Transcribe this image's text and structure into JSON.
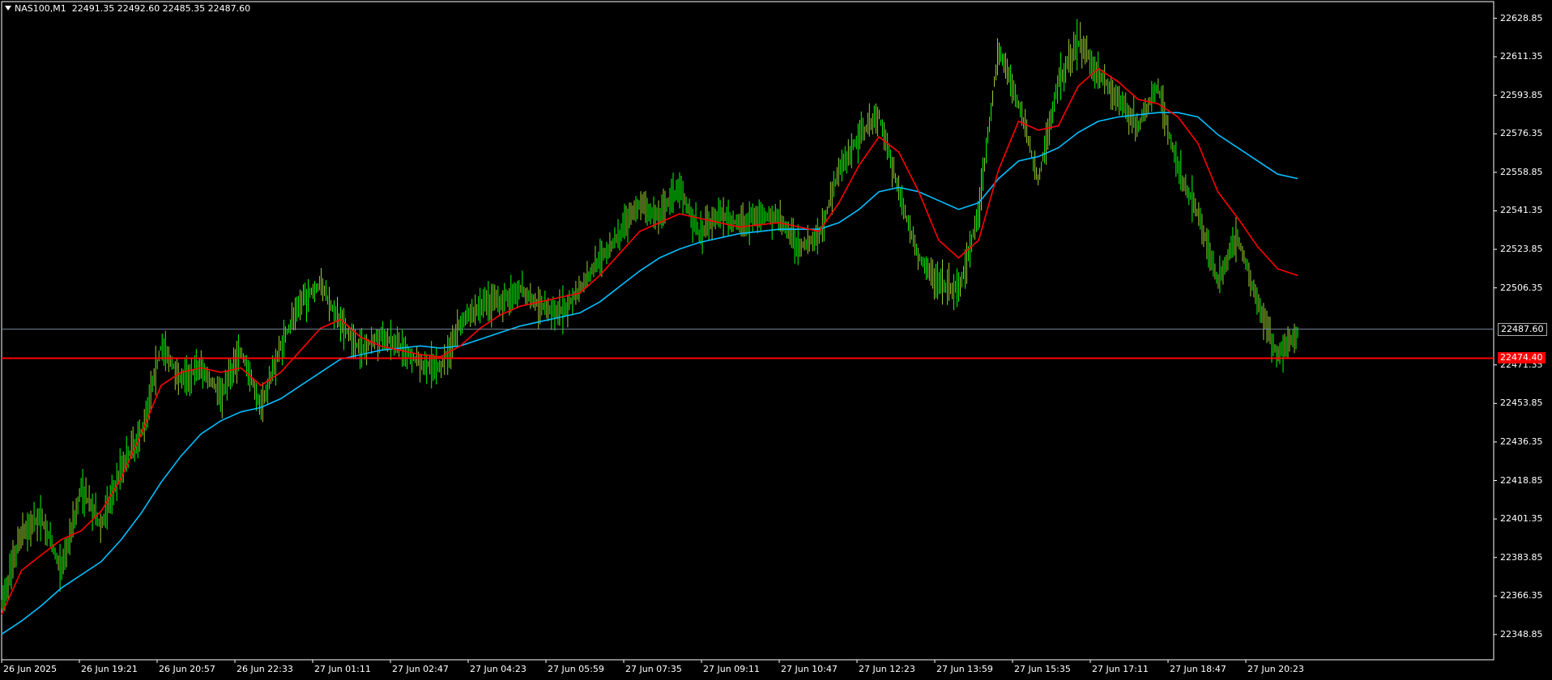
{
  "header": {
    "symbol": "NAS100,M1",
    "ohlc": "22491.35 22492.60 22485.35 22487.60"
  },
  "price_axis": {
    "labels": [
      "22628.85",
      "22611.35",
      "22593.85",
      "22576.35",
      "22558.85",
      "22541.35",
      "22523.85",
      "22506.35",
      "22471.35",
      "22453.85",
      "22436.35",
      "22418.85",
      "22401.35",
      "22383.85",
      "22366.35",
      "22348.85"
    ],
    "bid_label": "22487.60",
    "alert_label": "22474.40"
  },
  "time_axis": {
    "labels": [
      "26 Jun 2025",
      "26 Jun 19:21",
      "26 Jun 20:57",
      "26 Jun 22:33",
      "27 Jun 01:11",
      "27 Jun 02:47",
      "27 Jun 04:23",
      "27 Jun 05:59",
      "27 Jun 07:35",
      "27 Jun 09:11",
      "27 Jun 10:47",
      "27 Jun 12:23",
      "27 Jun 13:59",
      "27 Jun 15:35",
      "27 Jun 17:11",
      "27 Jun 18:47",
      "27 Jun 20:23"
    ]
  },
  "colors": {
    "background": "#000000",
    "bar_up": "#00ff00",
    "bar_mix": "#9acd32",
    "ma_fast": "#ff0000",
    "ma_slow": "#00bfff",
    "bid_line": "#778899",
    "alert_line": "#ff0000",
    "grid_frame": "#ffffff"
  },
  "chart_data": {
    "type": "line",
    "title": "NAS100,M1",
    "ylim": [
      22344.0,
      22632.0
    ],
    "x": [
      "26 Jun 2025",
      "26 Jun 19:21",
      "26 Jun 20:57",
      "26 Jun 22:33",
      "27 Jun 01:11",
      "27 Jun 02:47",
      "27 Jun 04:23",
      "27 Jun 05:59",
      "27 Jun 07:35",
      "27 Jun 09:11",
      "27 Jun 10:47",
      "27 Jun 12:23",
      "27 Jun 13:59",
      "27 Jun 15:35",
      "27 Jun 17:11",
      "27 Jun 18:47",
      "27 Jun 20:23"
    ],
    "price_path": [
      22362,
      22395,
      22402,
      22378,
      22415,
      22398,
      22425,
      22440,
      22480,
      22465,
      22470,
      22458,
      22478,
      22452,
      22480,
      22500,
      22508,
      22490,
      22478,
      22485,
      22480,
      22472,
      22470,
      22490,
      22498,
      22500,
      22506,
      22498,
      22495,
      22505,
      22520,
      22530,
      22545,
      22538,
      22553,
      22530,
      22540,
      22535,
      22540,
      22538,
      22525,
      22530,
      22560,
      22575,
      22585,
      22550,
      22520,
      22508,
      22505,
      22540,
      22615,
      22590,
      22555,
      22600,
      22618,
      22605,
      22592,
      22580,
      22598,
      22560,
      22540,
      22510,
      22530,
      22500,
      22475,
      22485
    ],
    "series": [
      {
        "name": "",
        "values": [
          22358,
          22378,
          22385,
          22392,
          22396,
          22405,
          22420,
          22440,
          22462,
          22468,
          22470,
          22468,
          22470,
          22462,
          22468,
          22478,
          22488,
          22492,
          22484,
          22480,
          22478,
          22476,
          22475,
          22480,
          22488,
          22494,
          22498,
          22500,
          22502,
          22504,
          22512,
          22522,
          22532,
          22536,
          22540,
          22538,
          22536,
          22534,
          22535,
          22536,
          22534,
          22532,
          22545,
          22562,
          22575,
          22568,
          22550,
          22528,
          22520,
          22528,
          22560,
          22582,
          22578,
          22580,
          22598,
          22606,
          22600,
          22592,
          22590,
          22584,
          22572,
          22550,
          22538,
          22525,
          22515,
          22512
        ]
      },
      {
        "name": "",
        "values": [
          22349,
          22355,
          22362,
          22370,
          22376,
          22382,
          22392,
          22404,
          22418,
          22430,
          22440,
          22446,
          22450,
          22452,
          22456,
          22462,
          22468,
          22474,
          22476,
          22478,
          22479,
          22480,
          22479,
          22480,
          22483,
          22486,
          22489,
          22491,
          22493,
          22495,
          22500,
          22507,
          22514,
          22520,
          22524,
          22527,
          22529,
          22531,
          22532,
          22533,
          22533,
          22533,
          22536,
          22542,
          22550,
          22552,
          22550,
          22546,
          22542,
          22545,
          22556,
          22564,
          22566,
          22570,
          22577,
          22582,
          22584,
          22585,
          22586,
          22586,
          22584,
          22576,
          22570,
          22564,
          22558,
          22556
        ]
      }
    ],
    "current_price": 22487.6,
    "alert_level": 22474.4,
    "grid": false,
    "legend": "none"
  }
}
